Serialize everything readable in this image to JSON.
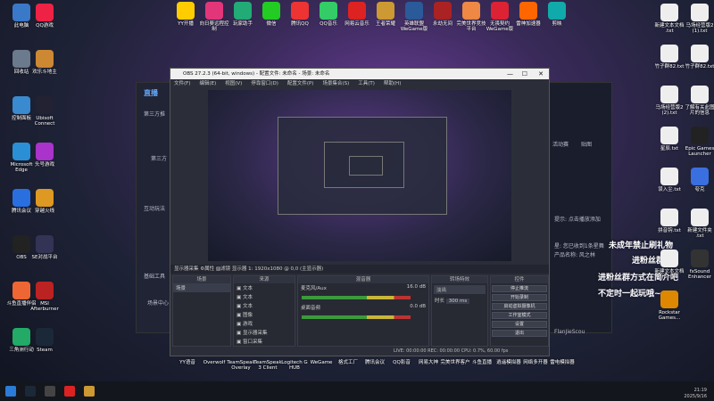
{
  "desktop_left": [
    {
      "label": "此电脑",
      "color": "#3a78c8"
    },
    {
      "label": "QQ游戏",
      "color": "#e24"
    },
    {
      "label": "回收站",
      "color": "#6b7a8c"
    },
    {
      "label": "欢乐斗地主",
      "color": "#c83"
    },
    {
      "label": "控制面板",
      "color": "#3a8ad0"
    },
    {
      "label": "Ubisoft\nConnect",
      "color": "#223"
    },
    {
      "label": "Microsoft\nEdge",
      "color": "#2a8fd4"
    },
    {
      "label": "头号游戏",
      "color": "#a3c"
    },
    {
      "label": "腾讯会议",
      "color": "#2a6fe0"
    },
    {
      "label": "穿越火线",
      "color": "#d92"
    },
    {
      "label": "OBS",
      "color": "#222"
    },
    {
      "label": "SE对战平台",
      "color": "#335"
    },
    {
      "label": "斗鱼直播伴侣",
      "color": "#e63"
    },
    {
      "label": "MSI\nAfterburner",
      "color": "#b22"
    },
    {
      "label": "三角洲行动",
      "color": "#2a6"
    },
    {
      "label": "Steam",
      "color": "#1b2838"
    }
  ],
  "desktop_top": [
    {
      "label": "YY开播",
      "color": "#fc0"
    },
    {
      "label": "向日葵远程控\n制",
      "color": "#e3367a"
    },
    {
      "label": "玩家助手",
      "color": "#2a7"
    },
    {
      "label": "微信",
      "color": "#2c2"
    },
    {
      "label": "腾讯QQ",
      "color": "#e33"
    },
    {
      "label": "QQ音乐",
      "color": "#3c6"
    },
    {
      "label": "网易云音乐",
      "color": "#d22"
    },
    {
      "label": "王者荣耀",
      "color": "#c93"
    },
    {
      "label": "英雄联盟\nWeGame版",
      "color": "#2a5a9a"
    },
    {
      "label": "永劫无间",
      "color": "#a22"
    },
    {
      "label": "完美世界竞技\n平台",
      "color": "#e84"
    },
    {
      "label": "无畏契约\nWeGame版",
      "color": "#d23"
    },
    {
      "label": "雷神加速器",
      "color": "#f60"
    },
    {
      "label": "剪映",
      "color": "#1aa"
    }
  ],
  "desktop_right": [
    {
      "label": "新建文本文档\n.txt",
      "color": "#eee"
    },
    {
      "label": "马场经营版2\n(1).txt",
      "color": "#eee"
    },
    {
      "label": "竹子群82.txt",
      "color": "#eee"
    },
    {
      "label": "竹子群82.txt",
      "color": "#eee"
    },
    {
      "label": "马场经营版2\n(2).txt",
      "color": "#eee"
    },
    {
      "label": "了解有关此图\n片的信息",
      "color": "#eee"
    },
    {
      "label": "星辰.txt",
      "color": "#eee"
    },
    {
      "label": "Epic Games\nLauncher",
      "color": "#222"
    },
    {
      "label": "误入尘.txt",
      "color": "#eee"
    },
    {
      "label": "夸克",
      "color": "#3a6fe0"
    },
    {
      "label": "拼音钩.txt",
      "color": "#eee"
    },
    {
      "label": "新建文件夹\n.txt",
      "color": "#eee"
    },
    {
      "label": "新建文本文档\n(3).txt",
      "color": "#eee"
    },
    {
      "label": "fxSound\nEnhancer",
      "color": "#333"
    },
    {
      "label": "Rockstar\nGames...",
      "color": "#d80"
    }
  ],
  "desktop_bottom": [
    {
      "label": "YY语音"
    },
    {
      "label": "Overwolf"
    },
    {
      "label": "TeamSpeak\nOverlay"
    },
    {
      "label": "TeamSpeak\n3 Client"
    },
    {
      "label": "Logitech G\nHUB"
    },
    {
      "label": "WeGame"
    },
    {
      "label": "格式工厂"
    },
    {
      "label": "腾讯会议"
    },
    {
      "label": "QQ影音"
    },
    {
      "label": "网易大神"
    },
    {
      "label": "完美世界客户"
    },
    {
      "label": "斗鱼直播"
    },
    {
      "label": "逍遥模拟器"
    },
    {
      "label": "网络多开器"
    },
    {
      "label": "雷电模拟器"
    }
  ],
  "obs": {
    "title": "OBS 27.2.3 (64-bit, windows) - 配置文件: 未命名 - 场景: 未命名",
    "menu": [
      "文件(F)",
      "编辑(E)",
      "视图(V)",
      "停靠窗口(D)",
      "配置文件(P)",
      "场景集合(S)",
      "工具(T)",
      "帮助(H)"
    ],
    "source_bar": "显示器采集   ⚙属性  ▨滤镜  显示器 1: 1920x1080 @ 0,0 (主显示器)",
    "docks": {
      "scenes": "场景",
      "sources": "来源",
      "mixer": "混音器",
      "transitions": "转场特效",
      "controls": "控件"
    },
    "scene_item": "场景",
    "source_items": [
      "文本",
      "文本",
      "文本",
      "图像",
      "游戏",
      "显示器采集",
      "窗口采集"
    ],
    "mixer_tracks": [
      {
        "name": "麦克风/Aux",
        "db": "16.0 dB"
      },
      {
        "name": "桌面音频",
        "db": "0.0 dB"
      }
    ],
    "transition_type": "淡出",
    "duration_label": "时长",
    "duration_value": "300 ms",
    "controls": [
      "停止推流",
      "开始录制",
      "启动虚拟摄像机",
      "工作室模式",
      "设置",
      "退出"
    ],
    "status": "LIVE: 00:00:00   REC: 00:00:00   CPU: 0.7%, 60.00 fps"
  },
  "live_app": {
    "logo": "直播",
    "left": [
      "第三方推",
      "第三方",
      "互动玩法",
      "基础工具",
      "场景中心"
    ],
    "right_tabs": [
      "活动赛",
      "贴图"
    ],
    "right_lines": [
      "星: 您已收到1条星舞",
      "产品名称: 风之林",
      "提示: 点击播放添加"
    ],
    "user": "FlanJieScou"
  },
  "banners": [
    "未成年禁止刷礼物",
    "进粉丝群",
    "进粉丝群方式在简介吧",
    "不定时一起玩哦~"
  ],
  "tray": {
    "time": "21:19",
    "date": "2025/9/16"
  }
}
